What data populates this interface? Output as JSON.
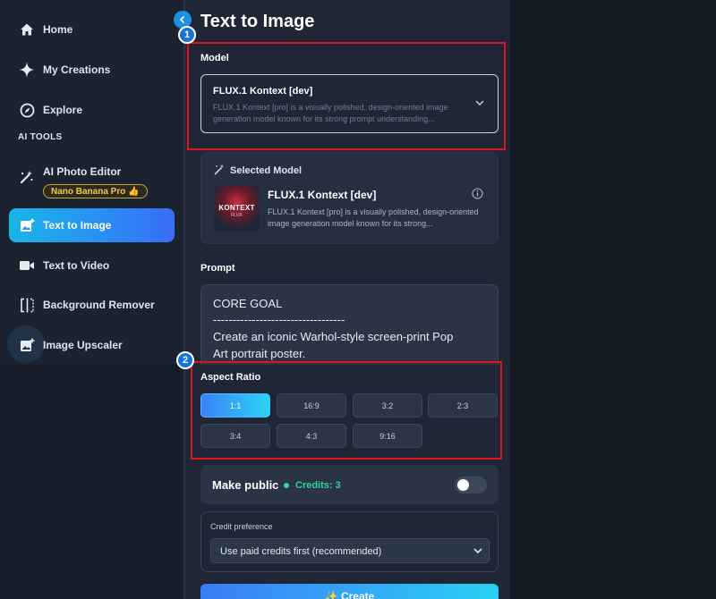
{
  "sidebar": {
    "items": [
      {
        "label": "Home",
        "icon": "home-icon"
      },
      {
        "label": "My Creations",
        "icon": "sparkle-icon"
      },
      {
        "label": "Explore",
        "icon": "compass-icon"
      },
      {
        "label": "AI Photo Editor",
        "icon": "magic-wand-icon",
        "badge": "Nano Banana Pro 👍"
      },
      {
        "label": "Text to Image",
        "icon": "image-plus-icon",
        "active": true
      },
      {
        "label": "Text to Video",
        "icon": "video-icon"
      },
      {
        "label": "Background Remover",
        "icon": "split-frame-icon"
      },
      {
        "label": "Image Upscaler",
        "icon": "image-plus-icon"
      }
    ],
    "section_label": "AI TOOLS"
  },
  "page": {
    "title": "Text to Image"
  },
  "model": {
    "label": "Model",
    "selected_name": "FLUX.1 Kontext [dev]",
    "selected_desc": "FLUX.1 Kontext [pro] is a visually polished, design-oriented image generation model known for its strong prompt understanding..."
  },
  "selected_model": {
    "header": "Selected Model",
    "name": "FLUX.1 Kontext [dev]",
    "desc": "FLUX.1 Kontext [pro] is a visually polished, design-oriented image generation model known for its strong...",
    "thumb_text": "KONTEXT",
    "thumb_sub": "FLUX"
  },
  "prompt": {
    "label": "Prompt",
    "lines": [
      "CORE GOAL",
      "----------------------------------",
      "Create an iconic Warhol-style screen-print Pop",
      "Art portrait poster."
    ]
  },
  "aspect_ratio": {
    "label": "Aspect Ratio",
    "options": [
      "1:1",
      "16:9",
      "3:2",
      "2:3",
      "3:4",
      "4:3",
      "9:16"
    ],
    "selected": "1:1"
  },
  "make_public": {
    "label": "Make public",
    "credits": "Credits: 3",
    "enabled": false
  },
  "credit_preference": {
    "label": "Credit preference",
    "value": "Use paid credits first (recommended)"
  },
  "generate": {
    "label": "✨ Create"
  },
  "annotations": [
    "1",
    "2"
  ],
  "colors": {
    "accent": "#1e8fe0",
    "annotation": "#e0141e",
    "credits": "#2fd39a"
  }
}
